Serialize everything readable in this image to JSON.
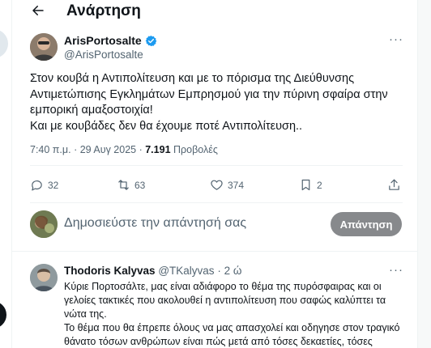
{
  "header": {
    "title": "Ανάρτηση"
  },
  "post": {
    "author_name": "ArisPortosalte",
    "author_handle": "@ArisPortosalte",
    "lines": [
      "Στον κουβά η Αντιπολίτευση και με το πόρισμα της Διεύθυνσης Αντιμετώπισης Εγκλημάτων Εμπρησμού για την πύρινη σφαίρα στην εμπορική αμαξοστοιχία!",
      "Και με κουβάδες δεν θα έχουμε ποτέ Αντιπολίτευση.."
    ],
    "time": "7:40 π.μ.",
    "date": "29 Αυγ 2025",
    "views_count": "7.191",
    "views_label": "Προβολές",
    "stats": {
      "replies": "32",
      "reposts": "63",
      "likes": "374",
      "bookmarks": "2"
    }
  },
  "reply_box": {
    "placeholder": "Δημοσιεύστε την απάντησή σας",
    "button_label": "Απάντηση"
  },
  "replies": [
    {
      "name": "Thodoris Kalyvas",
      "handle": "@TKalyvas",
      "age": "2 ώ",
      "lines": [
        "Κύριε Πορτοσάλτε, μας είναι αδιάφορο το θέμα της πυρόσφαιρας και οι γελοίες τακτικές που ακολουθεί η αντιπολίτευση που σαφώς καλύπτει τα νώτα της.",
        "Το θέμα που θα έπρεπε όλους να μας απασχολεί και οδηγησε στον τραγικό θάνατο τόσων ανθρώπων είναι πώς μετά από τόσες δεκαετίες, τόσες"
      ]
    }
  ],
  "colors": {
    "text": "#0f1419",
    "muted": "#536471",
    "verified": "#1d9bf0",
    "reply_button": "#87898c"
  }
}
